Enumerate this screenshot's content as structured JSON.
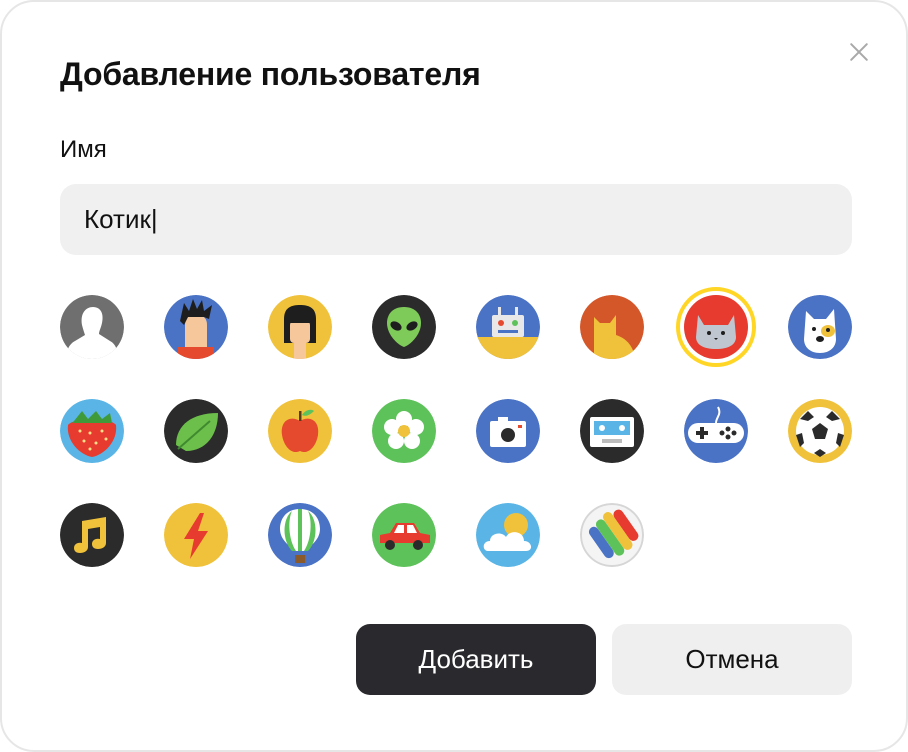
{
  "dialog": {
    "title": "Добавление пользователя",
    "name_label": "Имя",
    "name_value": "Котик|",
    "add_button": "Добавить",
    "cancel_button": "Отмена"
  },
  "avatars": [
    {
      "icon": "person-silhouette-icon",
      "selected": false
    },
    {
      "icon": "spiky-hair-man-icon",
      "selected": false
    },
    {
      "icon": "woman-black-hair-icon",
      "selected": false
    },
    {
      "icon": "alien-icon",
      "selected": false
    },
    {
      "icon": "robot-icon",
      "selected": false
    },
    {
      "icon": "orange-cat-icon",
      "selected": false
    },
    {
      "icon": "cat-face-icon",
      "selected": true
    },
    {
      "icon": "dog-icon",
      "selected": false
    },
    {
      "icon": "strawberry-icon",
      "selected": false
    },
    {
      "icon": "leaf-icon",
      "selected": false
    },
    {
      "icon": "apple-icon",
      "selected": false
    },
    {
      "icon": "flower-icon",
      "selected": false
    },
    {
      "icon": "camera-icon",
      "selected": false
    },
    {
      "icon": "cassette-icon",
      "selected": false
    },
    {
      "icon": "gamepad-icon",
      "selected": false
    },
    {
      "icon": "soccer-ball-icon",
      "selected": false
    },
    {
      "icon": "music-note-icon",
      "selected": false
    },
    {
      "icon": "lightning-icon",
      "selected": false
    },
    {
      "icon": "hot-air-balloon-icon",
      "selected": false
    },
    {
      "icon": "car-icon",
      "selected": false
    },
    {
      "icon": "sun-cloud-icon",
      "selected": false
    },
    {
      "icon": "color-stripes-icon",
      "selected": false
    }
  ],
  "colors": {
    "primary_button": "#2a2a2e",
    "secondary_button": "#efefef",
    "selection_ring": "#ffd626",
    "input_bg": "#f0f0f0"
  }
}
